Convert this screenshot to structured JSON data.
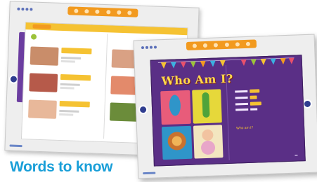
{
  "caption": "Words to know",
  "back_window": {
    "colors": {
      "toolbar": "#f29a1f",
      "page_accent": "#f5c232",
      "tab": "#6b3da0"
    }
  },
  "front_window": {
    "story_title": "Who Am I?",
    "answer_text": "Who am I?",
    "colors": {
      "page": "#5a2f86",
      "title": "#ffd94a",
      "highlight": "#f5c232"
    }
  },
  "colors": {
    "caption": "#1a9fd8"
  }
}
